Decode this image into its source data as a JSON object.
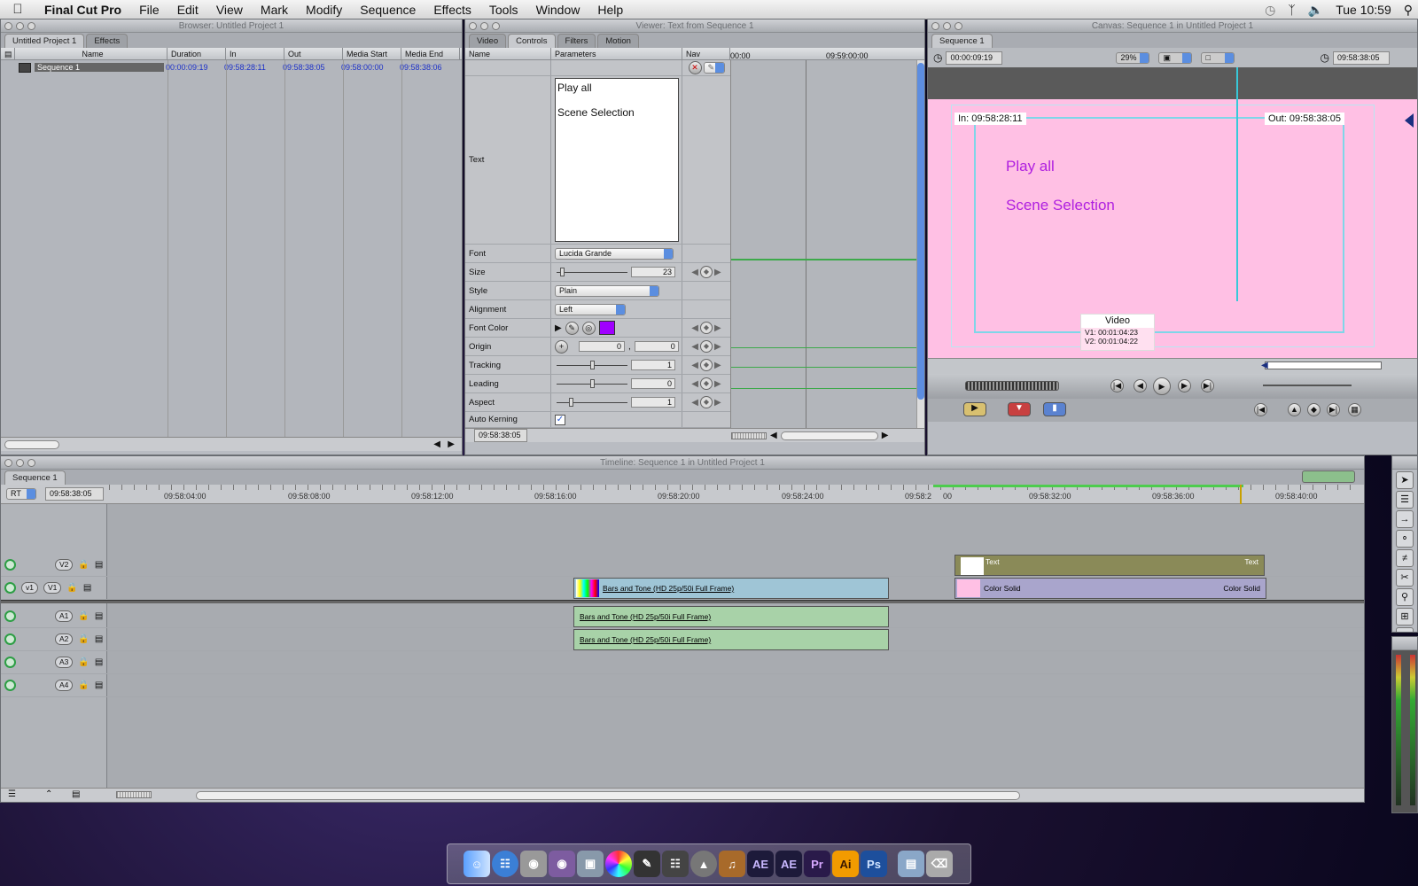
{
  "menubar": {
    "app": "Final Cut Pro",
    "items": [
      "File",
      "Edit",
      "View",
      "Mark",
      "Modify",
      "Sequence",
      "Effects",
      "Tools",
      "Window",
      "Help"
    ],
    "clock": "Tue 10:59"
  },
  "browser": {
    "title": "Browser: Untitled Project 1",
    "tabs": [
      "Untitled Project 1",
      "Effects"
    ],
    "columns": [
      "Name",
      "Duration",
      "In",
      "Out",
      "Media Start",
      "Media End"
    ],
    "row": {
      "name": "Sequence 1",
      "duration": "00:00:09:19",
      "in": "09:58:28:11",
      "out": "09:58:38:05",
      "media_start": "09:58:00:00",
      "media_end": "09:58:38:06"
    }
  },
  "viewer": {
    "title": "Viewer: Text from Sequence 1",
    "tabs": [
      "Video",
      "Controls",
      "Filters",
      "Motion"
    ],
    "columns": {
      "name": "Name",
      "params": "Parameters",
      "nav": "Nav"
    },
    "ruler": [
      "00:00",
      "09:59:00:00"
    ],
    "text_label": "Text",
    "text_lines": [
      "Play all",
      "Scene Selection"
    ],
    "params": [
      {
        "name": "Font",
        "value": "Lucida Grande"
      },
      {
        "name": "Size",
        "value": "23"
      },
      {
        "name": "Style",
        "value": "Plain"
      },
      {
        "name": "Alignment",
        "value": "Left"
      },
      {
        "name": "Font Color",
        "value": ""
      },
      {
        "name": "Origin",
        "x": "0",
        "y": "0"
      },
      {
        "name": "Tracking",
        "value": "1"
      },
      {
        "name": "Leading",
        "value": "0"
      },
      {
        "name": "Aspect",
        "value": "1"
      },
      {
        "name": "Auto Kerning",
        "value": ""
      }
    ],
    "timecode": "09:58:38:05",
    "font_color": "#a000ff"
  },
  "canvas": {
    "title": "Canvas: Sequence 1 in Untitled Project 1",
    "tab": "Sequence 1",
    "duration": "00:00:09:19",
    "zoom": "29%",
    "timecode": "09:58:38:05",
    "in": "In: 09:58:28:11",
    "out": "Out: 09:58:38:05",
    "line1": "Play all",
    "line2": "Scene Selection",
    "overlay": {
      "title": "Video",
      "v1": "V1: 00:01:04:23",
      "v2": "V2: 00:01:04:22"
    },
    "bg": "#ffc0e4",
    "text_color": "#b020e0"
  },
  "timeline": {
    "title": "Timeline: Sequence 1 in Untitled Project 1",
    "tab": "Sequence 1",
    "rt": "RT",
    "timecode": "09:58:38:05",
    "ticks": [
      "09:58:04:00",
      "09:58:08:00",
      "09:58:12:00",
      "09:58:16:00",
      "09:58:20:00",
      "09:58:24:00",
      "09:58:2",
      "00",
      "09:58:32:00",
      "09:58:36:00",
      "09:58:40:00"
    ],
    "tracks": {
      "v2": "V2",
      "v1": "V1",
      "v1src": "v1",
      "a1": "A1",
      "a2": "A2",
      "a3": "A3",
      "a4": "A4"
    },
    "clips": {
      "bars_v1": "Bars and Tone (HD 25p/50i Full Frame)",
      "bars_a1": "Bars and Tone (HD 25p/50i Full Frame)",
      "bars_a2": "Bars and Tone (HD 25p/50i Full Frame)",
      "text_left": "Text",
      "text_right": "Text",
      "solid_left": "Color Solid",
      "solid_right": "Color Solid"
    }
  },
  "dock": {
    "items": [
      "Finder",
      "Safari",
      "DVD Studio",
      "iDVD",
      "Preview",
      "Photo",
      "Motion",
      "Compressor",
      "Logic",
      "GarageBand",
      "AE",
      "AE",
      "Pr",
      "Ai",
      "Ps",
      "Folder",
      "Trash"
    ]
  }
}
